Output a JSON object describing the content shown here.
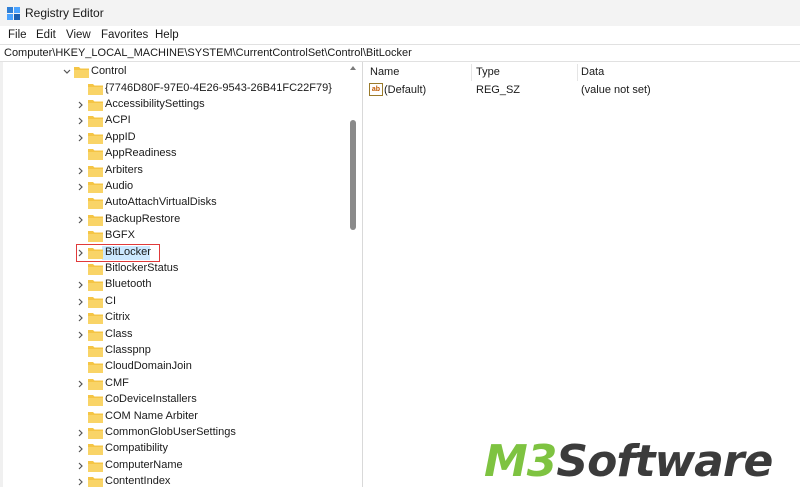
{
  "window": {
    "title": "Registry Editor"
  },
  "menu": [
    "File",
    "Edit",
    "View",
    "Favorites",
    "Help"
  ],
  "address": "Computer\\HKEY_LOCAL_MACHINE\\SYSTEM\\CurrentControlSet\\Control\\BitLocker",
  "tree": {
    "parent": "Control",
    "items": [
      {
        "label": "{7746D80F-97E0-4E26-9543-26B41FC22F79}",
        "expandable": false
      },
      {
        "label": "AccessibilitySettings",
        "expandable": true
      },
      {
        "label": "ACPI",
        "expandable": true
      },
      {
        "label": "AppID",
        "expandable": true
      },
      {
        "label": "AppReadiness",
        "expandable": false
      },
      {
        "label": "Arbiters",
        "expandable": true
      },
      {
        "label": "Audio",
        "expandable": true
      },
      {
        "label": "AutoAttachVirtualDisks",
        "expandable": false
      },
      {
        "label": "BackupRestore",
        "expandable": true
      },
      {
        "label": "BGFX",
        "expandable": false
      },
      {
        "label": "BitLocker",
        "expandable": true,
        "selected": true
      },
      {
        "label": "BitlockerStatus",
        "expandable": false
      },
      {
        "label": "Bluetooth",
        "expandable": true
      },
      {
        "label": "CI",
        "expandable": true
      },
      {
        "label": "Citrix",
        "expandable": true
      },
      {
        "label": "Class",
        "expandable": true
      },
      {
        "label": "Classpnp",
        "expandable": false
      },
      {
        "label": "CloudDomainJoin",
        "expandable": false
      },
      {
        "label": "CMF",
        "expandable": true
      },
      {
        "label": "CoDeviceInstallers",
        "expandable": false
      },
      {
        "label": "COM Name Arbiter",
        "expandable": false
      },
      {
        "label": "CommonGlobUserSettings",
        "expandable": true
      },
      {
        "label": "Compatibility",
        "expandable": true
      },
      {
        "label": "ComputerName",
        "expandable": true
      },
      {
        "label": "ContentIndex",
        "expandable": true
      }
    ]
  },
  "values_pane": {
    "headers": {
      "name": "Name",
      "type": "Type",
      "data": "Data"
    },
    "rows": [
      {
        "name": "(Default)",
        "type": "REG_SZ",
        "data": "(value not set)",
        "icon": "ab"
      }
    ]
  },
  "watermark": {
    "prefix": "M3",
    "suffix": "Software"
  },
  "colors": {
    "folder": "#f5c545",
    "highlight_box": "#e03a3a",
    "selection": "#cce8ff",
    "watermark_green": "#7ec341"
  }
}
